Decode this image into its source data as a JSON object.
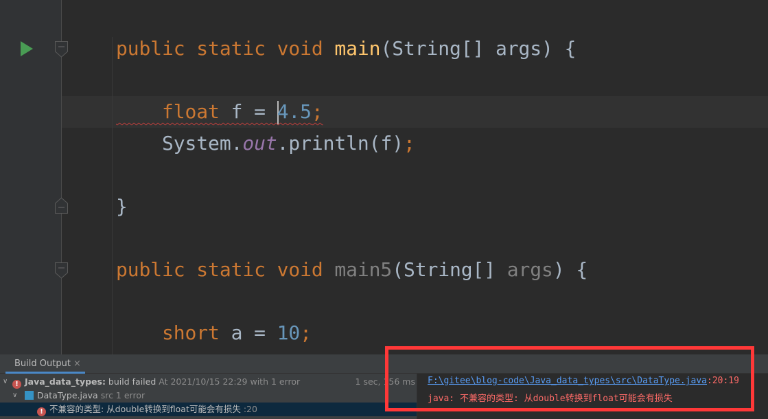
{
  "editor": {
    "lines": [
      {
        "row": 0,
        "tokens": [
          [
            "kw",
            "public static void "
          ],
          [
            "fn",
            "main"
          ],
          [
            "pl",
            "(String[] args) {"
          ]
        ]
      },
      {
        "row": 2,
        "tokens": [
          [
            "kw err",
            "    float"
          ],
          [
            "pl err",
            " f = "
          ],
          [
            "caret",
            ""
          ],
          [
            "num err",
            "4.5"
          ],
          [
            "kw err",
            ";"
          ]
        ]
      },
      {
        "row": 3,
        "tokens": [
          [
            "pl",
            "    System."
          ],
          [
            "st",
            "out"
          ],
          [
            "pl",
            ".println(f)"
          ],
          [
            "kw",
            ";"
          ]
        ]
      },
      {
        "row": 5,
        "tokens": [
          [
            "pl",
            "}"
          ]
        ]
      },
      {
        "row": 7,
        "tokens": [
          [
            "kw",
            "public static void "
          ],
          [
            "un",
            "main5"
          ],
          [
            "pl",
            "(String[] "
          ],
          [
            "un",
            "args"
          ],
          [
            "pl",
            ") {"
          ]
        ]
      },
      {
        "row": 9,
        "tokens": [
          [
            "kw",
            "    short"
          ],
          [
            "pl",
            " a = "
          ],
          [
            "num",
            "10"
          ],
          [
            "kw",
            ";"
          ]
        ]
      }
    ],
    "error_highlight_color": "#bc3f3c"
  },
  "panel": {
    "tab_label": "Build Output",
    "tab_close": "×",
    "tree": {
      "root": {
        "project": "Java_data_types:",
        "status": " build failed",
        "detail": " At 2021/10/15 22:29 with 1 error",
        "duration": "1 sec, 156 ms"
      },
      "file": {
        "name": "DataType.java",
        "detail": " src 1 error"
      },
      "error": {
        "message": "不兼容的类型: 从double转换到float可能会有损失",
        "line": " :20"
      }
    },
    "detail": {
      "path": "F:\\gitee\\blog-code\\Java_data_types\\src\\DataType.java",
      "position": ":20:19",
      "message": "java: 不兼容的类型: 从double转换到float可能会有损失"
    }
  },
  "colors": {
    "annotation_box": "#ff3838",
    "error": "#ff6b68",
    "link": "#589df6",
    "keyword": "#cc7832"
  }
}
